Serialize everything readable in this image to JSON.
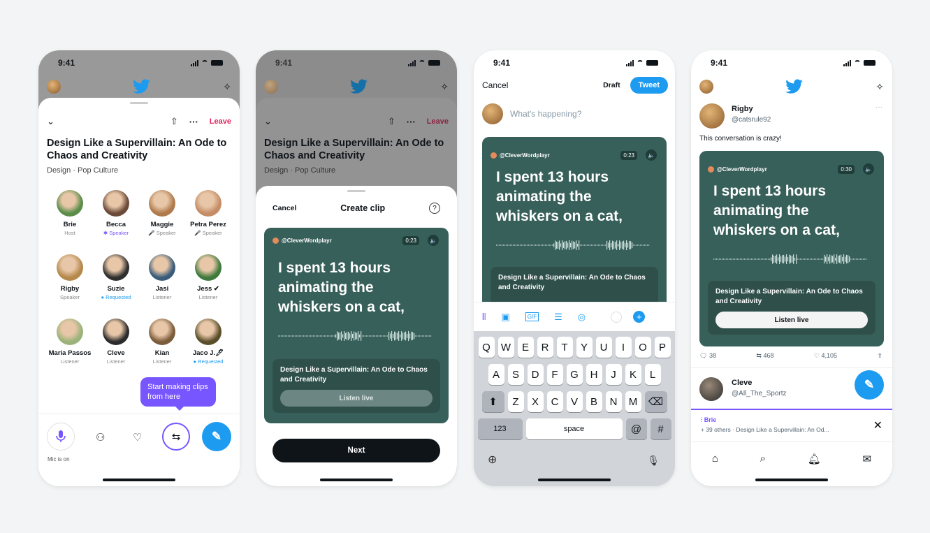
{
  "status": {
    "time": "9:41"
  },
  "space": {
    "leave_label": "Leave",
    "title": "Design Like a Supervillain: An Ode to Chaos and Creativity",
    "subtitle": "Design · Pop Culture",
    "participants": [
      {
        "name": "Brie",
        "role": "Host",
        "color": "#5b8d4a"
      },
      {
        "name": "Becca",
        "role": "✱ Speaker",
        "color": "#6b4a3a"
      },
      {
        "name": "Maggie",
        "role": "🎤 Speaker",
        "color": "#b07a4c"
      },
      {
        "name": "Petra Perez",
        "role": "🎤 Speaker",
        "color": "#c58d66"
      },
      {
        "name": "Rigby",
        "role": "Speaker",
        "color": "#b5894b"
      },
      {
        "name": "Suzie",
        "role": "● Requested",
        "color": "#2f2f2f"
      },
      {
        "name": "Jasi",
        "role": "Listener",
        "color": "#3a5c7a"
      },
      {
        "name": "Jess ✔",
        "role": "Listener",
        "color": "#3f7a3c"
      },
      {
        "name": "Maria Passos",
        "role": "Listener",
        "color": "#9bb37a"
      },
      {
        "name": "Cleve",
        "role": "Listener",
        "color": "#2b2b2b"
      },
      {
        "name": "Kian",
        "role": "Listener",
        "color": "#7a5b3a"
      },
      {
        "name": "Jaco J.🖊",
        "role": "● Requested",
        "color": "#5a4e2a"
      }
    ],
    "mic_label": "Mic is on",
    "tooltip": "Start making clips from here"
  },
  "clip": {
    "cancel": "Cancel",
    "title": "Create clip",
    "help": "?",
    "handle": "@CleverWordplayr",
    "duration": "0:23",
    "quote": "I spent 13 hours animating the whiskers on a cat,",
    "space_title": "Design Like a Supervillain: An Ode to Chaos and Creativity",
    "listen": "Listen live",
    "next": "Next"
  },
  "compose": {
    "cancel": "Cancel",
    "draft": "Draft",
    "tweet": "Tweet",
    "placeholder": "What's happening?",
    "handle": "@CleverWordplayr",
    "duration": "0:23",
    "quote": "I spent 13 hours animating the whiskers on a cat,",
    "space_title": "Design Like a Supervillain: An Ode to Chaos and Creativity",
    "keys_row1": [
      "Q",
      "W",
      "E",
      "R",
      "T",
      "Y",
      "U",
      "I",
      "O",
      "P"
    ],
    "keys_row2": [
      "A",
      "S",
      "D",
      "F",
      "G",
      "H",
      "J",
      "K",
      "L"
    ],
    "keys_row3": [
      "Z",
      "X",
      "C",
      "V",
      "B",
      "N",
      "M"
    ],
    "key_123": "123",
    "key_space": "space",
    "key_at": "@",
    "key_hash": "#"
  },
  "timeline": {
    "author_name": "Rigby",
    "author_handle": "@catsrule92",
    "text": "This conversation is crazy!",
    "handle": "@CleverWordplayr",
    "duration": "0:30",
    "quote": "I spent 13 hours animating the whiskers on a cat,",
    "space_title": "Design Like a Supervillain: An Ode to Chaos and Creativity",
    "listen": "Listen live",
    "replies": "38",
    "retweets": "468",
    "likes": "4,105",
    "next_name": "Cleve",
    "next_handle": "@All_The_Sportz",
    "bar_host": "Brie",
    "bar_text": "+ 39 others · Design Like a Supervillain: An Od..."
  }
}
